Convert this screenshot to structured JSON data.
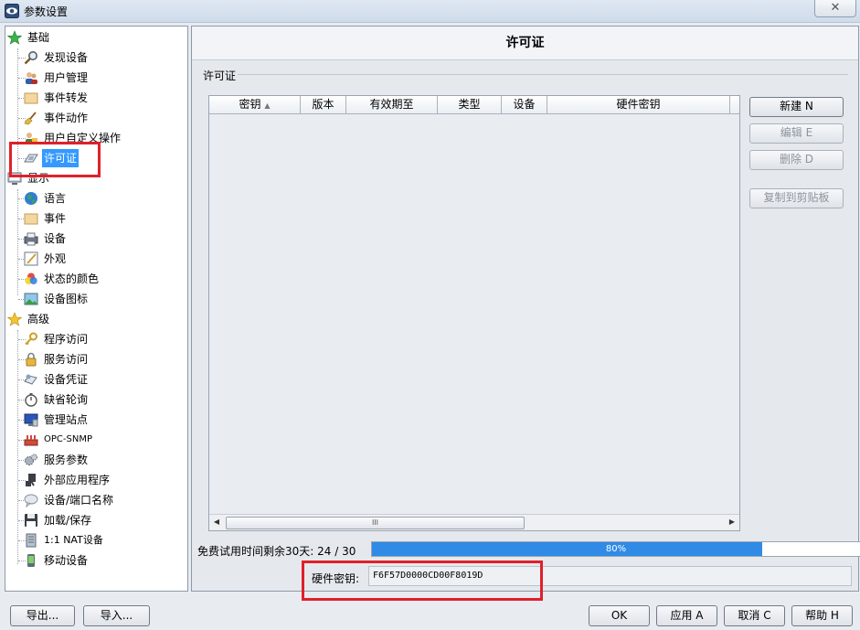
{
  "window": {
    "title": "参数设置",
    "close_label": "✕"
  },
  "tree": {
    "groups": [
      {
        "label": "基础",
        "icon": "green-star-icon"
      },
      {
        "label": "显示",
        "icon": "display-icon"
      },
      {
        "label": "高级",
        "icon": "yellow-star-icon"
      }
    ],
    "items": [
      {
        "label": "发现设备",
        "icon": "magnifier-icon"
      },
      {
        "label": "用户管理",
        "icon": "users-icon"
      },
      {
        "label": "事件转发",
        "icon": "folder-icon"
      },
      {
        "label": "事件动作",
        "icon": "broom-icon"
      },
      {
        "label": "用户自定义操作",
        "icon": "custom-action-icon"
      },
      {
        "label": "许可证",
        "icon": "license-icon"
      },
      {
        "label": "语言",
        "icon": "globe-icon"
      },
      {
        "label": "事件",
        "icon": "folder-icon"
      },
      {
        "label": "设备",
        "icon": "printer-icon"
      },
      {
        "label": "外观",
        "icon": "appearance-icon"
      },
      {
        "label": "状态的颜色",
        "icon": "color-circles-icon"
      },
      {
        "label": "设备图标",
        "icon": "image-icon"
      },
      {
        "label": "程序访问",
        "icon": "key-icon"
      },
      {
        "label": "服务访问",
        "icon": "lock-icon"
      },
      {
        "label": "设备凭证",
        "icon": "credential-icon"
      },
      {
        "label": "缺省轮询",
        "icon": "stopwatch-icon"
      },
      {
        "label": "管理站点",
        "icon": "monitor-icon"
      },
      {
        "label": "OPC-SNMP",
        "icon": "opc-icon"
      },
      {
        "label": "服务参数",
        "icon": "gears-icon"
      },
      {
        "label": "外部应用程序",
        "icon": "external-app-icon"
      },
      {
        "label": "设备/端口名称",
        "icon": "speech-bubble-icon"
      },
      {
        "label": "加载/保存",
        "icon": "floppy-disk-icon"
      },
      {
        "label": "1:1 NAT设备",
        "icon": "server-icon"
      },
      {
        "label": "移动设备",
        "icon": "mobile-icon"
      }
    ],
    "selected": "许可证"
  },
  "panel": {
    "title": "许可证",
    "group_label": "许可证",
    "columns": [
      "密钥",
      "版本",
      "有效期至",
      "类型",
      "设备",
      "硬件密钥"
    ],
    "sort_indicator": "▲",
    "scroll_grip": "III",
    "buttons": {
      "new": "新建 N",
      "edit": "编辑 E",
      "delete": "删除 D",
      "copy": "复制到剪贴板"
    },
    "trial_label": "免费试用时间剩余30天:  24 / 30",
    "trial_progress": 0.8,
    "trial_progress_text": "80%",
    "hardware_key_label": "硬件密钥:",
    "hardware_key_value": "F6F57D0000CD00F8019D"
  },
  "footer": {
    "export": "导出...",
    "import": "导入...",
    "ok": "OK",
    "apply": "应用 A",
    "cancel": "取消 C",
    "help": "帮助 H"
  },
  "colors": {
    "highlight": "#e0202a",
    "selection": "#3399ff",
    "progress": "#2f8be6"
  }
}
